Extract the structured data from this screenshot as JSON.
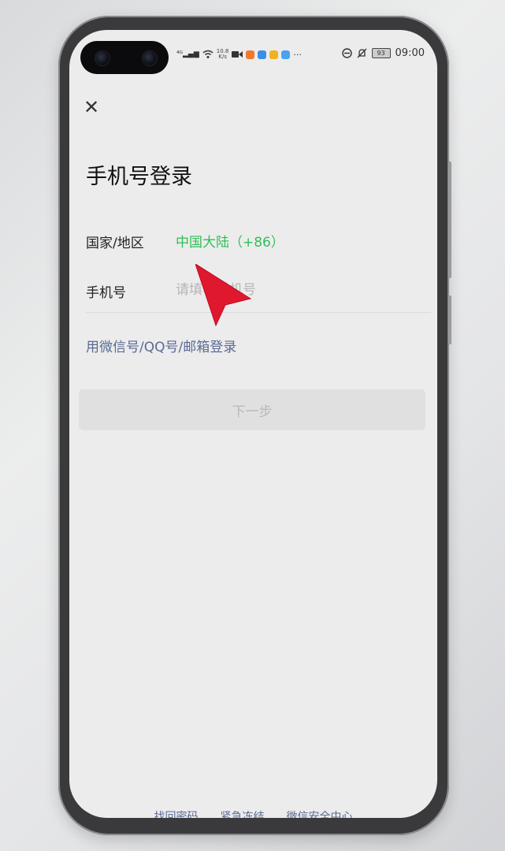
{
  "status_bar": {
    "signal": "⁴ᴳ▂▄▆",
    "net_speed_value": "10.8",
    "net_speed_unit": "K/s",
    "more": "···",
    "battery": "93",
    "time": "09:00"
  },
  "header": {
    "close_icon": "✕",
    "title": "手机号登录"
  },
  "form": {
    "country_label": "国家/地区",
    "country_value": "中国大陆（+86）",
    "phone_label": "手机号",
    "phone_placeholder": "请填写手机号",
    "phone_value": ""
  },
  "alt_login_label": "用微信号/QQ号/邮箱登录",
  "next_button_label": "下一步",
  "footer": {
    "recover_password": "找回密码",
    "emergency_freeze": "紧急冻结",
    "security_center": "微信安全中心"
  },
  "colors": {
    "accent_green": "#2fbf58",
    "link_blue": "#5a6a95",
    "cursor_red": "#e0182d"
  }
}
